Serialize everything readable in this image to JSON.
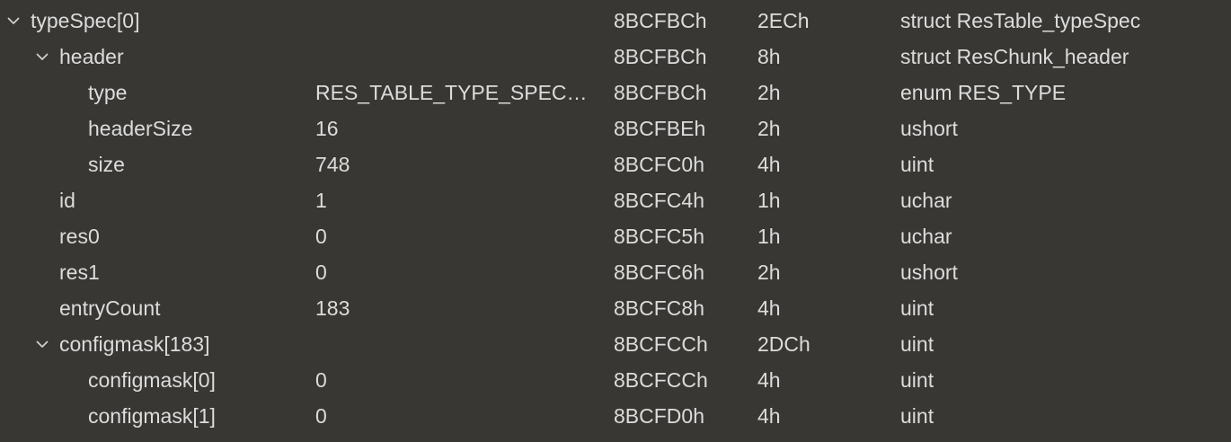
{
  "rows": [
    {
      "name": "typeSpec[0]",
      "value": "",
      "start": "8BCFBCh",
      "size": "2ECh",
      "type": "struct ResTable_typeSpec",
      "depth": 0,
      "expanded": true
    },
    {
      "name": "header",
      "value": "",
      "start": "8BCFBCh",
      "size": "8h",
      "type": "struct ResChunk_header",
      "depth": 1,
      "expanded": true
    },
    {
      "name": "type",
      "value": "RES_TABLE_TYPE_SPEC…",
      "start": "8BCFBCh",
      "size": "2h",
      "type": "enum RES_TYPE",
      "depth": 2,
      "expanded": null
    },
    {
      "name": "headerSize",
      "value": "16",
      "start": "8BCFBEh",
      "size": "2h",
      "type": "ushort",
      "depth": 2,
      "expanded": null
    },
    {
      "name": "size",
      "value": "748",
      "start": "8BCFC0h",
      "size": "4h",
      "type": "uint",
      "depth": 2,
      "expanded": null
    },
    {
      "name": "id",
      "value": "1",
      "start": "8BCFC4h",
      "size": "1h",
      "type": "uchar",
      "depth": 1,
      "expanded": null
    },
    {
      "name": "res0",
      "value": "0",
      "start": "8BCFC5h",
      "size": "1h",
      "type": "uchar",
      "depth": 1,
      "expanded": null
    },
    {
      "name": "res1",
      "value": "0",
      "start": "8BCFC6h",
      "size": "2h",
      "type": "ushort",
      "depth": 1,
      "expanded": null
    },
    {
      "name": "entryCount",
      "value": "183",
      "start": "8BCFC8h",
      "size": "4h",
      "type": "uint",
      "depth": 1,
      "expanded": null
    },
    {
      "name": "configmask[183]",
      "value": "",
      "start": "8BCFCCh",
      "size": "2DCh",
      "type": "uint",
      "depth": 1,
      "expanded": true
    },
    {
      "name": "configmask[0]",
      "value": "0",
      "start": "8BCFCCh",
      "size": "4h",
      "type": "uint",
      "depth": 2,
      "expanded": null
    },
    {
      "name": "configmask[1]",
      "value": "0",
      "start": "8BCFD0h",
      "size": "4h",
      "type": "uint",
      "depth": 2,
      "expanded": null
    }
  ],
  "icons": {
    "expanded": "chevron-down-icon"
  },
  "colors": {
    "background": "#383733",
    "text": "#dcdcdc"
  }
}
